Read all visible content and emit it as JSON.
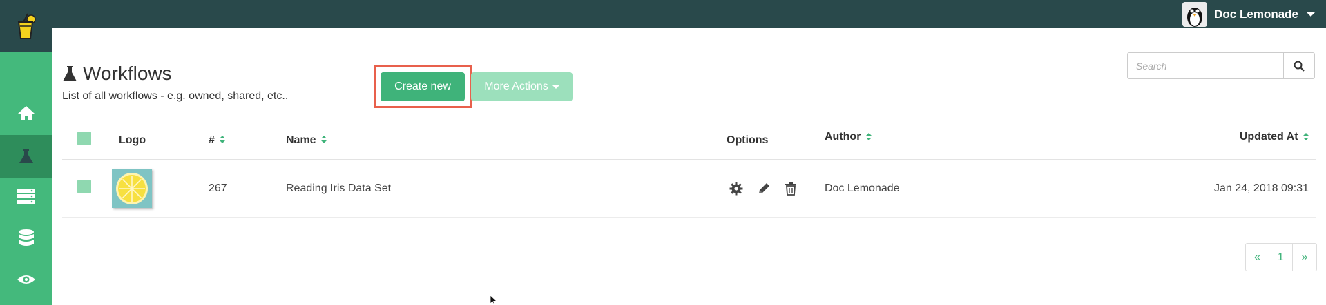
{
  "header": {
    "user_name": "Doc Lemonade"
  },
  "sidebar": {
    "items": [
      {
        "icon": "home-icon"
      },
      {
        "icon": "flask-icon",
        "active": true
      },
      {
        "icon": "server-icon"
      },
      {
        "icon": "database-icon"
      },
      {
        "icon": "eye-icon"
      }
    ]
  },
  "page": {
    "title": "Workflows",
    "subtitle": "List of all workflows - e.g. owned, shared, etc.."
  },
  "actions": {
    "create_label": "Create new",
    "more_label": "More Actions"
  },
  "search": {
    "placeholder": "Search"
  },
  "table": {
    "columns": {
      "logo": "Logo",
      "id": "#",
      "name": "Name",
      "options": "Options",
      "author": "Author",
      "updated": "Updated At"
    },
    "rows": [
      {
        "id": "267",
        "name": "Reading Iris Data Set",
        "author": "Doc Lemonade",
        "updated": "Jan 24, 2018 09:31"
      }
    ]
  },
  "pagination": {
    "prev": "«",
    "page": "1",
    "next": "»"
  },
  "colors": {
    "topbar": "#29494b",
    "sidebar": "#44b97c",
    "accent": "#3fb37a",
    "highlight": "#e8604c"
  }
}
